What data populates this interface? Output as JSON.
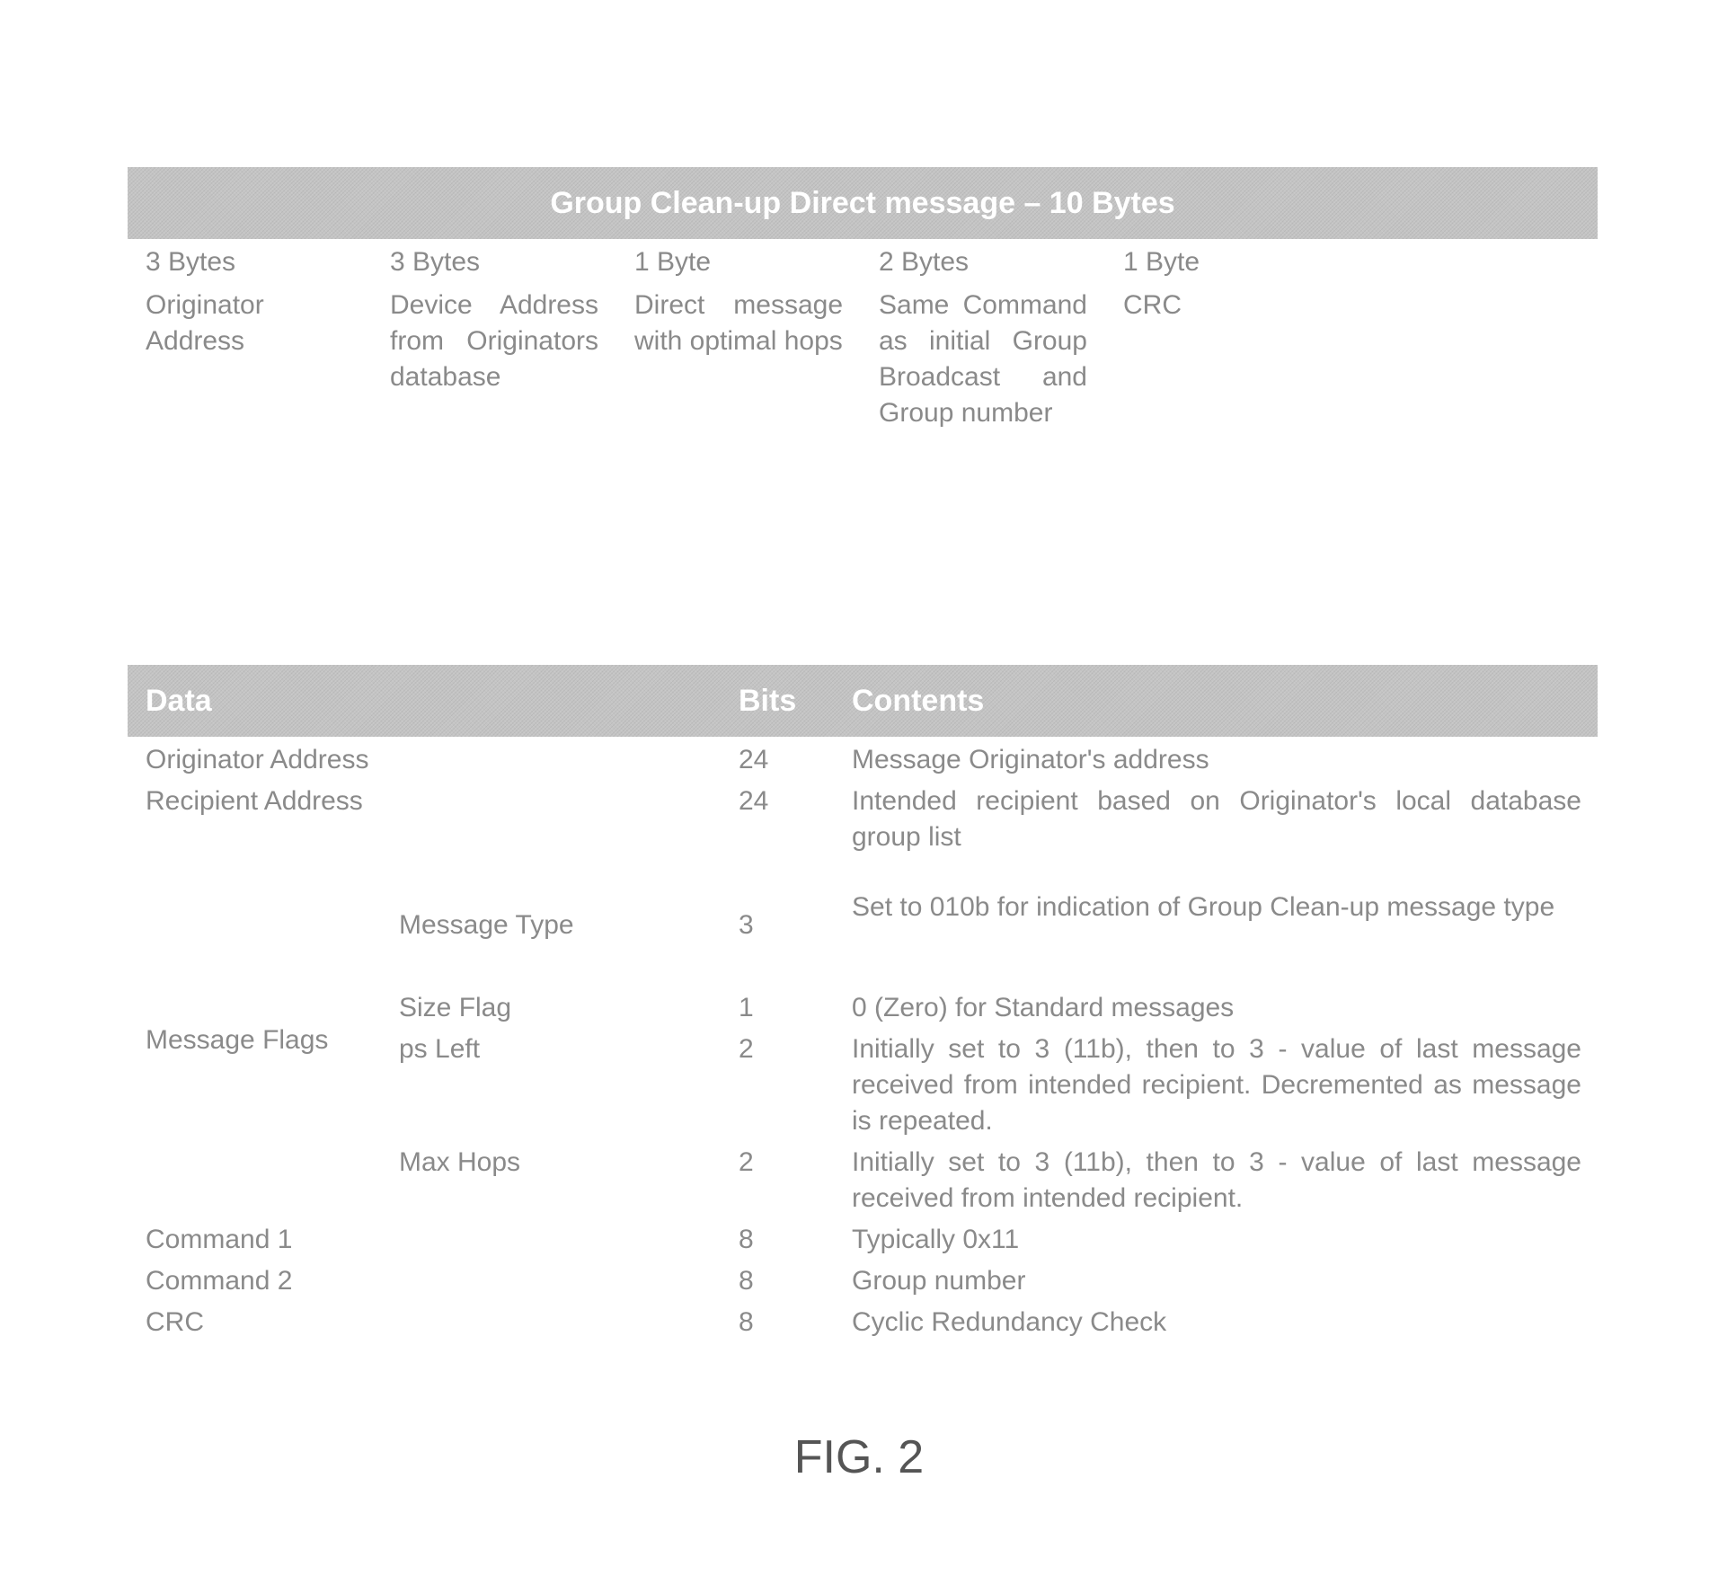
{
  "table1": {
    "title": "Group Clean-up  Direct  message – 10 Bytes",
    "columns": [
      {
        "size": "3 Bytes",
        "description": "Originator Address"
      },
      {
        "size": "3 Bytes",
        "description": "Device Address from Originators database"
      },
      {
        "size": "1 Byte",
        "description": "Direct message with optimal hops"
      },
      {
        "size": "2 Bytes",
        "description": "Same Command as initial Group Broadcast and Group number"
      },
      {
        "size": "1 Byte",
        "description": "CRC"
      }
    ]
  },
  "table2": {
    "headers": {
      "data": "Data",
      "bits": "Bits",
      "contents": "Contents"
    },
    "rows": [
      {
        "data": "Originator Address",
        "bits": "24",
        "contents": "Message Originator's address"
      },
      {
        "data": "Recipient Address",
        "bits": "24",
        "contents": "Intended recipient based on Originator's local database group list"
      },
      {
        "subfield": "Message Type",
        "bits": "3",
        "contents": "Set to 010b for indication of Group Clean-up message type"
      },
      {
        "subfield": "Size Flag",
        "bits": "1",
        "contents": "0 (Zero) for Standard messages"
      },
      {
        "subfield": "ps Left",
        "bits": "2",
        "contents": "Initially set to 3 (11b), then to 3 - value of last message received from intended recipient. Decremented as message is repeated."
      },
      {
        "subfield": "Max Hops",
        "bits": "2",
        "contents": "Initially set to 3 (11b), then to 3 - value of last message received from intended recipient."
      },
      {
        "data": "Command 1",
        "bits": "8",
        "contents": "Typically 0x11"
      },
      {
        "data": "Command 2",
        "bits": "8",
        "contents": "Group number"
      },
      {
        "data": "CRC",
        "bits": "8",
        "contents": "Cyclic Redundancy Check"
      }
    ],
    "group_label": "Message Flags"
  },
  "figure_caption": "FIG. 2"
}
